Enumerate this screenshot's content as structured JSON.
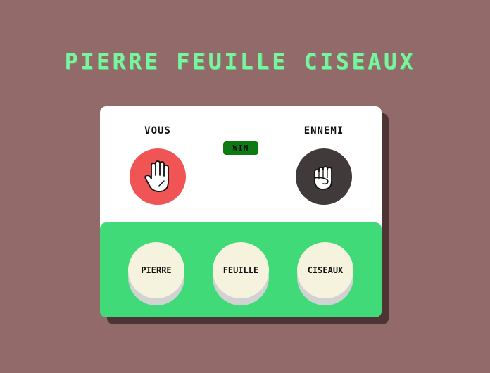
{
  "title": "PIERRE FEUILLE CISEAUX",
  "players": {
    "you": {
      "label": "VOUS",
      "choice_icon": "hand-paper-icon",
      "color": "#f05454"
    },
    "enemy": {
      "label": "ENNEMI",
      "choice_icon": "hand-rock-icon",
      "color": "#403b3a"
    }
  },
  "result": {
    "label": "WIN",
    "color": "#0d7a12"
  },
  "choices": [
    {
      "label": "PIERRE"
    },
    {
      "label": "FEUILLE"
    },
    {
      "label": "CISEAUX"
    }
  ],
  "colors": {
    "background": "#916a69",
    "title": "#7cf49d",
    "panel": "#41da79",
    "button": "#f5f3dd"
  }
}
